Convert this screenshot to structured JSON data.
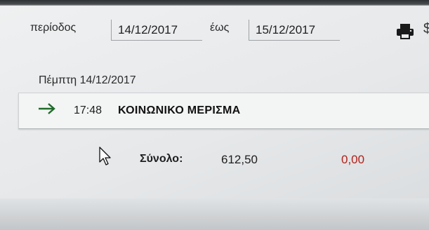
{
  "filter": {
    "period_label": "περίοδος",
    "from_date": "14/12/2017",
    "to_label": "έως",
    "to_date": "15/12/2017"
  },
  "toolbar": {
    "print_icon": "printer-icon",
    "edge_glyph": "$"
  },
  "day": {
    "header": "Πέμπτη 14/12/2017",
    "events": [
      {
        "icon": "arrow-right-icon",
        "time": "17:48",
        "title": "ΚΟΙΝΩΝΙΚΟ ΜΕΡΙΣΜΑ"
      }
    ]
  },
  "totals": {
    "label": "Σύνολο:",
    "value": "612,50",
    "negative_value": "0,00"
  },
  "colors": {
    "arrow": "#1f6b2a",
    "negative": "#b0211b"
  }
}
